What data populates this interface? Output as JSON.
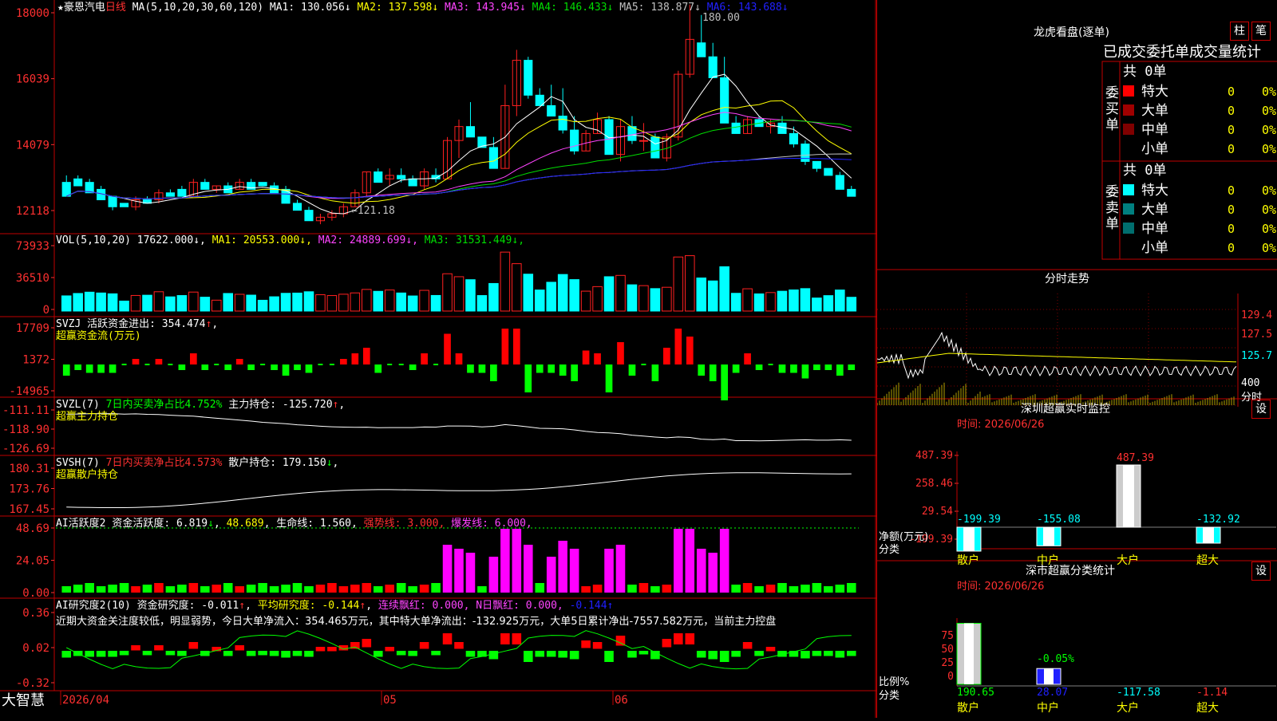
{
  "colors": {
    "up": "#ff2020",
    "down": "#00ffff",
    "ma1": "#ffffff",
    "ma2": "#ffff00",
    "ma3": "#ff44ff",
    "ma4": "#00dd00",
    "ma5": "#c0c0c0",
    "ma6": "#2020ff",
    "border": "#c00000",
    "axis": "#ff3030",
    "grid": "#800000"
  },
  "kline": {
    "title_star": "★",
    "stock": "豪恩汽电",
    "period": "日线",
    "ma_label": "MA(5,10,20,30,60,120)",
    "ma": [
      {
        "name": "MA1:",
        "value": "130.056",
        "arrow": "↓",
        "color": "#ffffff"
      },
      {
        "name": "MA2:",
        "value": "137.598",
        "arrow": "↓",
        "color": "#ffff00"
      },
      {
        "name": "MA3:",
        "value": "143.945",
        "arrow": "↓",
        "color": "#ff44ff"
      },
      {
        "name": "MA4:",
        "value": "146.433",
        "arrow": "↓",
        "color": "#00dd00"
      },
      {
        "name": "MA5:",
        "value": "138.877",
        "arrow": "↓",
        "color": "#c0c0c0"
      },
      {
        "name": "MA6:",
        "value": "143.688",
        "arrow": "↓",
        "color": "#2020ff"
      }
    ],
    "y_ticks": [
      "18000",
      "16039",
      "14079",
      "12118"
    ],
    "high_mark": "180.00",
    "low_mark": "←121.18"
  },
  "candles": [
    [
      130,
      132,
      128,
      126
    ],
    [
      131,
      132,
      129,
      129
    ],
    [
      130,
      131,
      127,
      127
    ],
    [
      128,
      129,
      125,
      125
    ],
    [
      126,
      126,
      122,
      123
    ],
    [
      124,
      124,
      123,
      123
    ],
    [
      123,
      126,
      122,
      125
    ],
    [
      125,
      126,
      124,
      124
    ],
    [
      125,
      128,
      124,
      127
    ],
    [
      127,
      128,
      126,
      126
    ],
    [
      128,
      129,
      126,
      126
    ],
    [
      126,
      131,
      126,
      130
    ],
    [
      130,
      131,
      128,
      128
    ],
    [
      128,
      129,
      127,
      129
    ],
    [
      129,
      130,
      127,
      127
    ],
    [
      128,
      131,
      128,
      130
    ],
    [
      130,
      131,
      128,
      128
    ],
    [
      130,
      130,
      129,
      129
    ],
    [
      129,
      130,
      127,
      127
    ],
    [
      128,
      129,
      124,
      124
    ],
    [
      124,
      125,
      122,
      122
    ],
    [
      122,
      123,
      119,
      119
    ],
    [
      119,
      121,
      118,
      120
    ],
    [
      120,
      122,
      119,
      121
    ],
    [
      121,
      124,
      120,
      123
    ],
    [
      123,
      128,
      123,
      127
    ],
    [
      127,
      133,
      126,
      133
    ],
    [
      133,
      134,
      130,
      130
    ],
    [
      131,
      134,
      129,
      132
    ],
    [
      132,
      134,
      130,
      131
    ],
    [
      131,
      132,
      129,
      129
    ],
    [
      129,
      134,
      128,
      133
    ],
    [
      132,
      134,
      130,
      131
    ],
    [
      131,
      143,
      131,
      142
    ],
    [
      142,
      148,
      137,
      146
    ],
    [
      146,
      153,
      143,
      143
    ],
    [
      143,
      143,
      140,
      140
    ],
    [
      140,
      143,
      134,
      134
    ],
    [
      134,
      158,
      134,
      152
    ],
    [
      152,
      168,
      149,
      165
    ],
    [
      165,
      166,
      154,
      155
    ],
    [
      155,
      157,
      152,
      152
    ],
    [
      152,
      158,
      149,
      149
    ],
    [
      149,
      157,
      144,
      145
    ],
    [
      145,
      149,
      138,
      139
    ],
    [
      139,
      145,
      139,
      144
    ],
    [
      144,
      150,
      144,
      148
    ],
    [
      148,
      149,
      138,
      138
    ],
    [
      138,
      148,
      136,
      146
    ],
    [
      146,
      149,
      141,
      142
    ],
    [
      142,
      147,
      139,
      142
    ],
    [
      143,
      144,
      137,
      137
    ],
    [
      137,
      144,
      136,
      143
    ],
    [
      143,
      162,
      142,
      161
    ],
    [
      161,
      181,
      160,
      171
    ],
    [
      170,
      178,
      167,
      166
    ],
    [
      166,
      170,
      160,
      160
    ],
    [
      160,
      166,
      149,
      147
    ],
    [
      147,
      149,
      144,
      144
    ],
    [
      144,
      149,
      144,
      148
    ],
    [
      148,
      149,
      146,
      146
    ],
    [
      146,
      148,
      144,
      147
    ],
    [
      147,
      149,
      144,
      144
    ],
    [
      144,
      146,
      140,
      141
    ],
    [
      141,
      142,
      135,
      136
    ],
    [
      136,
      136,
      133,
      134
    ],
    [
      134,
      134,
      132,
      132
    ],
    [
      132,
      133,
      128,
      128
    ],
    [
      128,
      129,
      127,
      126
    ]
  ],
  "vol": {
    "label": "VOL(5,10,20)",
    "value": "17622.000",
    "ma": [
      {
        "name": "MA1:",
        "value": "20553.000",
        "arrow": "↓",
        "color": "#ffff00"
      },
      {
        "name": "MA2:",
        "value": "24889.699",
        "arrow": "↓",
        "color": "#ff44ff"
      },
      {
        "name": "MA3:",
        "value": "31531.449",
        "arrow": "↓",
        "color": "#00dd00"
      }
    ],
    "y_ticks": [
      "73933",
      "36510",
      "0"
    ]
  },
  "svzj": {
    "label1": "SVZJ",
    "label2": "活跃资金进出:",
    "value": "354.474",
    "arrow": "↑",
    "comma": ",",
    "sub": "超赢资金流(万元)",
    "y_ticks": [
      "17709",
      "1372",
      "-14965"
    ]
  },
  "svzl": {
    "label1": "SVZL",
    "n": "(7)",
    "ratio_label": "7日内买卖净占比4.752%",
    "hold_label": "主力持仓:",
    "hold": "-125.720",
    "arrow": "↑",
    "comma": ",",
    "sub": "超赢主力持仓",
    "y_ticks": [
      "-111.11",
      "-118.90",
      "-126.69"
    ]
  },
  "svsh": {
    "label1": "SVSH",
    "n": "(7)",
    "ratio_label": "7日内买卖净占比4.573%",
    "hold_label": "散户持仓:",
    "hold": "179.150",
    "arrow": "↓",
    "comma": ",",
    "sub": "超赢散户持仓",
    "y_ticks": [
      "180.31",
      "173.76",
      "167.45"
    ]
  },
  "ai2": {
    "label": "AI活跃度2",
    "act_label": "资金活跃度:",
    "act": "6.819",
    "arrow1": "↓",
    "v2": "48.689",
    "life_label": "生命线:",
    "life": "1.560",
    "strong": "强势线: 3.000",
    "burst": "爆发线: 6.000",
    "y_ticks": [
      "48.69",
      "24.05",
      "0.00"
    ]
  },
  "ai_research": {
    "label": "AI研究度2(10)",
    "r_label": "资金研究度:",
    "r": "-0.011",
    "arrow": "↑",
    "avg_label": "平均研究度:",
    "avg": "-0.144",
    "arrow2": "↑",
    "red_label": "连续飘红:",
    "red": "0.000",
    "n_label": "N日飘红:",
    "n": "0.000",
    "last": "-0.144",
    "arrow3": "↑",
    "note": "近期大资金关注度较低，明显弱势，今日大单净流入：354.465万元，其中特大单净流出：-132.925万元，大单5日累计净出-7557.582万元，当前主力控盘",
    "y_ticks": [
      "0.36",
      "0.02",
      "-0.32"
    ]
  },
  "xaxis": {
    "labels": [
      "2026/04",
      "05",
      "06"
    ],
    "brand": "大智慧"
  },
  "right": {
    "btn_zhu": "柱",
    "btn_bi": "笔",
    "dragon_title": "龙虎看盘(逐单)",
    "order_title": "已成交委托单成交量统计",
    "buy_label": "委买单",
    "sell_label": "委卖单",
    "buy_total": "共 0单",
    "sell_total": "共 0单",
    "buy_rows": [
      {
        "name": "特大",
        "vol": "0",
        "pct": "0%",
        "color": "#ff0000"
      },
      {
        "name": "大单",
        "vol": "0",
        "pct": "0%",
        "color": "#a00000"
      },
      {
        "name": "中单",
        "vol": "0",
        "pct": "0%",
        "color": "#800000"
      },
      {
        "name": "小单",
        "vol": "0",
        "pct": "0%",
        "color": ""
      }
    ],
    "sell_rows": [
      {
        "name": "特大",
        "vol": "0",
        "pct": "0%",
        "color": "#00ffff"
      },
      {
        "name": "大单",
        "vol": "0",
        "pct": "0%",
        "color": "#008080"
      },
      {
        "name": "中单",
        "vol": "0",
        "pct": "0%",
        "color": "#006e6e"
      },
      {
        "name": "小单",
        "vol": "0",
        "pct": "0%",
        "color": ""
      }
    ],
    "intraday_title": "分时走势",
    "intraday_ticks": [
      "129.4",
      "127.5",
      "125.7",
      "400",
      "分时"
    ],
    "monitor_title": "深圳超赢实时监控",
    "set1": "设",
    "monitor_time": "时间: 2026/06/26",
    "monitor_y": [
      "487.39",
      "258.46",
      "29.54",
      "-199.39"
    ],
    "monitor_bars": [
      {
        "cat": "散户",
        "value": "-199.39",
        "num": -199.39
      },
      {
        "cat": "中户",
        "value": "-155.08",
        "num": -155.08
      },
      {
        "cat": "大户",
        "value": "487.39",
        "num": 487.39
      },
      {
        "cat": "超大",
        "value": "-132.92",
        "num": -132.92
      }
    ],
    "monitor_ylabel1": "净额(万元)",
    "monitor_ylabel2": "分类",
    "stat_title": "深市超赢分类统计",
    "set2": "设",
    "stat_time": "时间: 2026/06/26",
    "stat_y": [
      "75",
      "50",
      "25",
      "0"
    ],
    "stat_pct": "-0.05%",
    "stat_bars": [
      {
        "cat": "散户",
        "value": "190.65",
        "ratio": 85
      },
      {
        "cat": "中户",
        "value": "28.07",
        "ratio": 22
      },
      {
        "cat": "大户",
        "value": "-117.58",
        "ratio": 0
      },
      {
        "cat": "超大",
        "value": "-1.14",
        "ratio": 0
      }
    ],
    "stat_ylabel1": "比例%",
    "stat_ylabel2": "分类"
  }
}
